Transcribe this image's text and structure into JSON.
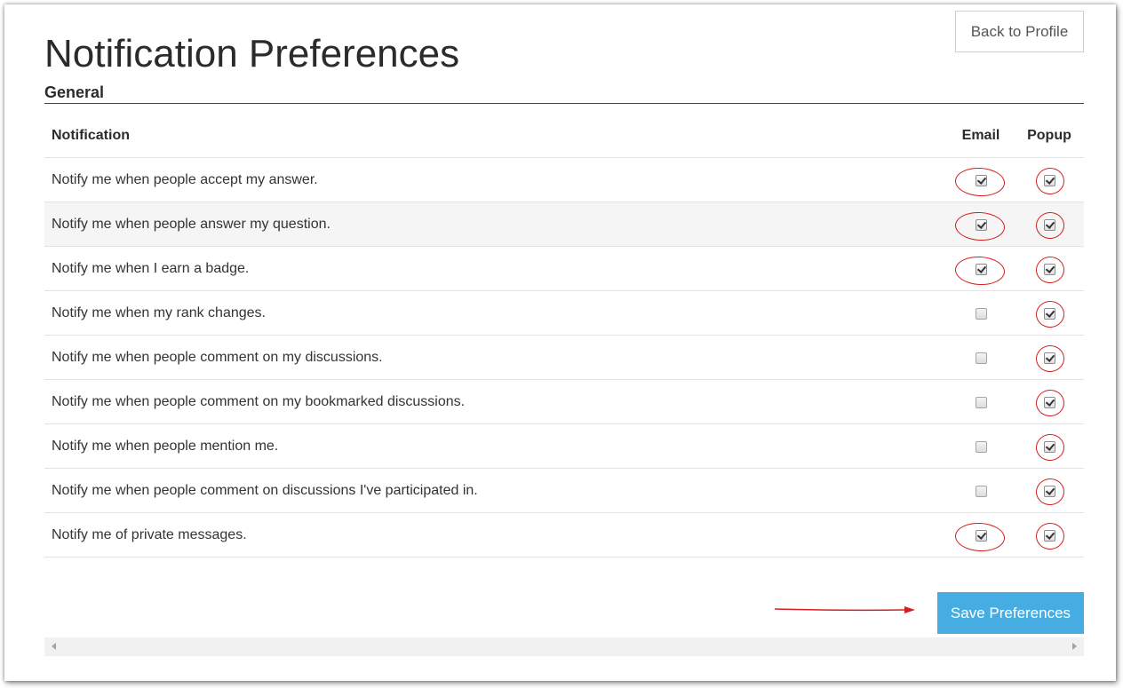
{
  "header": {
    "back_label": "Back to Profile",
    "title": "Notification Preferences",
    "section": "General"
  },
  "table": {
    "columns": {
      "notification": "Notification",
      "email": "Email",
      "popup": "Popup"
    },
    "rows": [
      {
        "label": "Notify me when people accept my answer.",
        "email": true,
        "popup": true
      },
      {
        "label": "Notify me when people answer my question.",
        "email": true,
        "popup": true
      },
      {
        "label": "Notify me when I earn a badge.",
        "email": true,
        "popup": true
      },
      {
        "label": "Notify me when my rank changes.",
        "email": false,
        "popup": true
      },
      {
        "label": "Notify me when people comment on my discussions.",
        "email": false,
        "popup": true
      },
      {
        "label": "Notify me when people comment on my bookmarked discussions.",
        "email": false,
        "popup": true
      },
      {
        "label": "Notify me when people mention me.",
        "email": false,
        "popup": true
      },
      {
        "label": "Notify me when people comment on discussions I've participated in.",
        "email": false,
        "popup": true
      },
      {
        "label": "Notify me of private messages.",
        "email": true,
        "popup": true
      }
    ]
  },
  "footer": {
    "save_label": "Save Preferences"
  },
  "colors": {
    "accent": "#45ade2",
    "annotation": "#d61f1f"
  }
}
